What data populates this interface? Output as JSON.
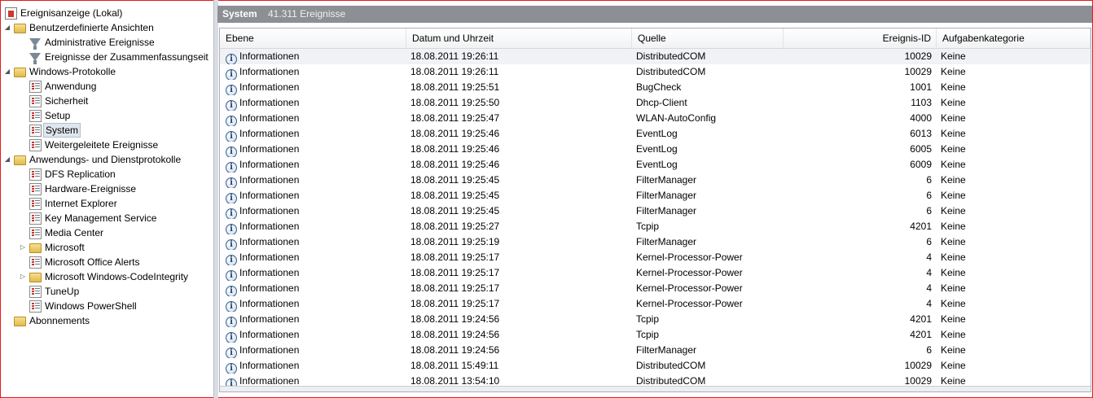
{
  "tree": [
    {
      "label": "Ereignisanzeige (Lokal)",
      "icon": "root-icon",
      "depth": 0,
      "expander": ""
    },
    {
      "label": "Benutzerdefinierte Ansichten",
      "icon": "folder-icon",
      "depth": 1,
      "expander": "◢"
    },
    {
      "label": "Administrative Ereignisse",
      "icon": "filter-icon",
      "depth": 2,
      "expander": ""
    },
    {
      "label": "Ereignisse der Zusammenfassungseit",
      "icon": "filter-icon",
      "depth": 2,
      "expander": ""
    },
    {
      "label": "Windows-Protokolle",
      "icon": "folder-icon",
      "depth": 1,
      "expander": "◢"
    },
    {
      "label": "Anwendung",
      "icon": "log-icon",
      "depth": 2,
      "expander": ""
    },
    {
      "label": "Sicherheit",
      "icon": "log-icon",
      "depth": 2,
      "expander": ""
    },
    {
      "label": "Setup",
      "icon": "log-icon",
      "depth": 2,
      "expander": ""
    },
    {
      "label": "System",
      "icon": "log-icon",
      "depth": 2,
      "expander": "",
      "selected": true
    },
    {
      "label": "Weitergeleitete Ereignisse",
      "icon": "log-icon",
      "depth": 2,
      "expander": ""
    },
    {
      "label": "Anwendungs- und Dienstprotokolle",
      "icon": "folder-icon",
      "depth": 1,
      "expander": "◢"
    },
    {
      "label": "DFS Replication",
      "icon": "log-icon",
      "depth": 2,
      "expander": ""
    },
    {
      "label": "Hardware-Ereignisse",
      "icon": "log-icon",
      "depth": 2,
      "expander": ""
    },
    {
      "label": "Internet Explorer",
      "icon": "log-icon",
      "depth": 2,
      "expander": ""
    },
    {
      "label": "Key Management Service",
      "icon": "log-icon",
      "depth": 2,
      "expander": ""
    },
    {
      "label": "Media Center",
      "icon": "log-icon",
      "depth": 2,
      "expander": ""
    },
    {
      "label": "Microsoft",
      "icon": "folder-icon",
      "depth": 2,
      "expander": "▷"
    },
    {
      "label": "Microsoft Office Alerts",
      "icon": "log-icon",
      "depth": 2,
      "expander": ""
    },
    {
      "label": "Microsoft Windows-CodeIntegrity",
      "icon": "folder-icon",
      "depth": 2,
      "expander": "▷"
    },
    {
      "label": "TuneUp",
      "icon": "log-icon",
      "depth": 2,
      "expander": ""
    },
    {
      "label": "Windows PowerShell",
      "icon": "log-icon",
      "depth": 2,
      "expander": ""
    },
    {
      "label": "Abonnements",
      "icon": "folder-icon",
      "depth": 1,
      "expander": ""
    }
  ],
  "header": {
    "title": "System",
    "count": "41.311 Ereignisse"
  },
  "columns": {
    "ebene": "Ebene",
    "datum": "Datum und Uhrzeit",
    "quelle": "Quelle",
    "id": "Ereignis-ID",
    "kategorie": "Aufgabenkategorie"
  },
  "rows": [
    {
      "ebene": "Informationen",
      "datum": "18.08.2011 19:26:11",
      "quelle": "DistributedCOM",
      "id": "10029",
      "kategorie": "Keine"
    },
    {
      "ebene": "Informationen",
      "datum": "18.08.2011 19:26:11",
      "quelle": "DistributedCOM",
      "id": "10029",
      "kategorie": "Keine"
    },
    {
      "ebene": "Informationen",
      "datum": "18.08.2011 19:25:51",
      "quelle": "BugCheck",
      "id": "1001",
      "kategorie": "Keine"
    },
    {
      "ebene": "Informationen",
      "datum": "18.08.2011 19:25:50",
      "quelle": "Dhcp-Client",
      "id": "1103",
      "kategorie": "Keine"
    },
    {
      "ebene": "Informationen",
      "datum": "18.08.2011 19:25:47",
      "quelle": "WLAN-AutoConfig",
      "id": "4000",
      "kategorie": "Keine"
    },
    {
      "ebene": "Informationen",
      "datum": "18.08.2011 19:25:46",
      "quelle": "EventLog",
      "id": "6013",
      "kategorie": "Keine"
    },
    {
      "ebene": "Informationen",
      "datum": "18.08.2011 19:25:46",
      "quelle": "EventLog",
      "id": "6005",
      "kategorie": "Keine"
    },
    {
      "ebene": "Informationen",
      "datum": "18.08.2011 19:25:46",
      "quelle": "EventLog",
      "id": "6009",
      "kategorie": "Keine"
    },
    {
      "ebene": "Informationen",
      "datum": "18.08.2011 19:25:45",
      "quelle": "FilterManager",
      "id": "6",
      "kategorie": "Keine"
    },
    {
      "ebene": "Informationen",
      "datum": "18.08.2011 19:25:45",
      "quelle": "FilterManager",
      "id": "6",
      "kategorie": "Keine"
    },
    {
      "ebene": "Informationen",
      "datum": "18.08.2011 19:25:45",
      "quelle": "FilterManager",
      "id": "6",
      "kategorie": "Keine"
    },
    {
      "ebene": "Informationen",
      "datum": "18.08.2011 19:25:27",
      "quelle": "Tcpip",
      "id": "4201",
      "kategorie": "Keine"
    },
    {
      "ebene": "Informationen",
      "datum": "18.08.2011 19:25:19",
      "quelle": "FilterManager",
      "id": "6",
      "kategorie": "Keine"
    },
    {
      "ebene": "Informationen",
      "datum": "18.08.2011 19:25:17",
      "quelle": "Kernel-Processor-Power",
      "id": "4",
      "kategorie": "Keine"
    },
    {
      "ebene": "Informationen",
      "datum": "18.08.2011 19:25:17",
      "quelle": "Kernel-Processor-Power",
      "id": "4",
      "kategorie": "Keine"
    },
    {
      "ebene": "Informationen",
      "datum": "18.08.2011 19:25:17",
      "quelle": "Kernel-Processor-Power",
      "id": "4",
      "kategorie": "Keine"
    },
    {
      "ebene": "Informationen",
      "datum": "18.08.2011 19:25:17",
      "quelle": "Kernel-Processor-Power",
      "id": "4",
      "kategorie": "Keine"
    },
    {
      "ebene": "Informationen",
      "datum": "18.08.2011 19:24:56",
      "quelle": "Tcpip",
      "id": "4201",
      "kategorie": "Keine"
    },
    {
      "ebene": "Informationen",
      "datum": "18.08.2011 19:24:56",
      "quelle": "Tcpip",
      "id": "4201",
      "kategorie": "Keine"
    },
    {
      "ebene": "Informationen",
      "datum": "18.08.2011 19:24:56",
      "quelle": "FilterManager",
      "id": "6",
      "kategorie": "Keine"
    },
    {
      "ebene": "Informationen",
      "datum": "18.08.2011 15:49:11",
      "quelle": "DistributedCOM",
      "id": "10029",
      "kategorie": "Keine"
    },
    {
      "ebene": "Informationen",
      "datum": "18.08.2011 13:54:10",
      "quelle": "DistributedCOM",
      "id": "10029",
      "kategorie": "Keine"
    }
  ],
  "colors": {
    "frame": "#e31b1b",
    "header_bg": "#8c8f94",
    "selection": "#dfe6ee"
  }
}
